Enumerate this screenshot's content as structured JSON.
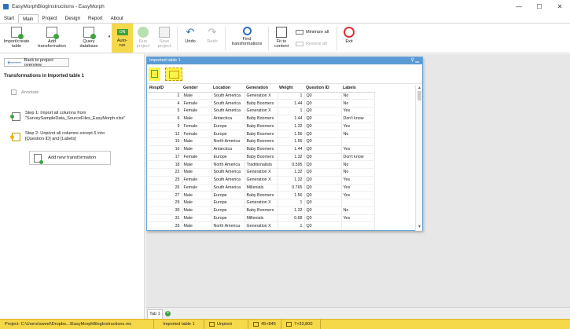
{
  "window": {
    "title": "EasyMorphBlogInstructions - EasyMorph",
    "controls": {
      "minimize": "—",
      "maximize": "☐",
      "close": "✕"
    }
  },
  "menu_tabs": [
    "Start",
    "Main",
    "Project",
    "Design",
    "Report",
    "About"
  ],
  "ribbon": {
    "import_create_table": "Import/create\ntable",
    "add_transformation": "Add\ntransformation",
    "query_database": "Query\ndatabase",
    "auto_run_badge": "ON",
    "auto_run": "Auto-\nrun",
    "run_project": "Run\nproject",
    "save_project": "Save\nproject",
    "undo": "Undo",
    "redo": "Redo",
    "find_transformations": "Find\ntransformations",
    "fit_to_content": "Fit to\ncontent",
    "minimize_all": "Minimize all",
    "restore_all": "Restore all",
    "exit": "Exit"
  },
  "left_pane": {
    "back_button": "Back to project overview",
    "heading": "Transformations in Imported table 1",
    "annotate": "Annotate",
    "steps": [
      {
        "text": "Step 1: Import all columns from\n\"SurveySampleData_SourceFiles_EasyMorph.xlsx\""
      },
      {
        "text": "Step 2: Unpivot all columns except 5 into\n[Question ID] and [Labels]"
      }
    ],
    "add_new_transformation": "Add new transformation"
  },
  "table_window": {
    "title": "Imported table 1",
    "title_controls": "⚲ ▁",
    "columns": [
      "RespID",
      "Gender",
      "Location",
      "Generation",
      "Weight",
      "Question ID",
      "Labels"
    ],
    "rows": [
      [
        "2",
        "Male",
        "South America",
        "Generation X",
        "1",
        "Q0",
        "No"
      ],
      [
        "4",
        "Female",
        "South America",
        "Baby Boomers",
        "1.44",
        "Q0",
        "No"
      ],
      [
        "5",
        "Female",
        "South America",
        "Generation X",
        "1",
        "Q0",
        "Yes"
      ],
      [
        "6",
        "Male",
        "Antarctica",
        "Baby Boomers",
        "1.44",
        "Q0",
        "Don't know"
      ],
      [
        "9",
        "Female",
        "Europe",
        "Baby Boomers",
        "1.32",
        "Q0",
        "Yes"
      ],
      [
        "12",
        "Female",
        "Europe",
        "Baby Boomers",
        "1.56",
        "Q0",
        "No"
      ],
      [
        "15",
        "Male",
        "North America",
        "Baby Boomers",
        "1.56",
        "Q0",
        ""
      ],
      [
        "16",
        "Male",
        "Antarctica",
        "Baby Boomers",
        "1.44",
        "Q0",
        "Yes"
      ],
      [
        "17",
        "Female",
        "Europe",
        "Baby Boomers",
        "1.32",
        "Q0",
        "Don't know"
      ],
      [
        "18",
        "Male",
        "North America",
        "Traditionalists",
        "0.595",
        "Q0",
        "No"
      ],
      [
        "22",
        "Male",
        "South America",
        "Generation X",
        "1.32",
        "Q0",
        "No"
      ],
      [
        "25",
        "Female",
        "South America",
        "Generation X",
        "1.32",
        "Q0",
        "Yes"
      ],
      [
        "26",
        "Female",
        "South America",
        "Millenials",
        "0.765",
        "Q0",
        "Yes"
      ],
      [
        "27",
        "Male",
        "Europe",
        "Baby Boomers",
        "1.56",
        "Q0",
        "Yes"
      ],
      [
        "29",
        "Male",
        "Europe",
        "Generation X",
        "1",
        "Q0",
        ""
      ],
      [
        "30",
        "Male",
        "Europe",
        "Baby Boomers",
        "1.32",
        "Q0",
        "No"
      ],
      [
        "31",
        "Male",
        "Europe",
        "Millenials",
        "0.68",
        "Q0",
        "Yes"
      ],
      [
        "33",
        "Male",
        "North America",
        "Generation X",
        "1",
        "Q0",
        ""
      ]
    ]
  },
  "tabs": {
    "sheet_tab": "Tab 1",
    "add_tab": "+"
  },
  "status_bar": {
    "project": "Project: C:\\Users\\sweel\\Dropbo...\\EasyMorphBlogInstructions.mc",
    "table": "Imported table 1",
    "transformation": "Unpivot",
    "columns_rows": "45×845",
    "unpivot_size": "7×33,800"
  },
  "colors": {
    "accent": "#2b6fbf",
    "status_bar": "#f6d94a",
    "table_title": "#5b9bd5",
    "highlight": "#fff34a"
  }
}
